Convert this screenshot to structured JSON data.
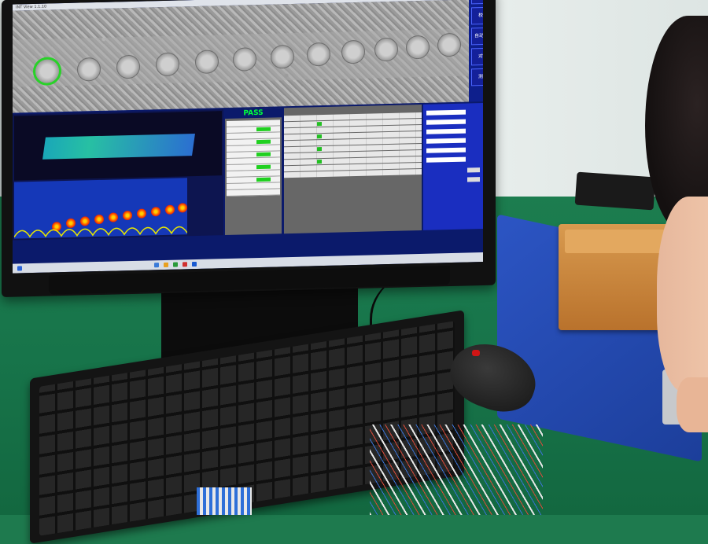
{
  "screen": {
    "window_title": "INT View 1.1.10",
    "result_label": "PASS",
    "result_table_headers": [
      "Name",
      "Result"
    ],
    "side_buttons": [
      "设 置",
      "校 准",
      "自动聚焦",
      "对 焦",
      "测 量"
    ]
  },
  "colors": {
    "screen_bg": "#0b1a6b",
    "pass_color": "#00ff3c",
    "selected_core": "#28d228",
    "desk_green": "#1c7d4f",
    "box_blue": "#2c55c4"
  },
  "objects": {
    "keyboard_icon": "keyboard",
    "mouse_icon": "mouse",
    "monitor_icon": "monitor"
  }
}
